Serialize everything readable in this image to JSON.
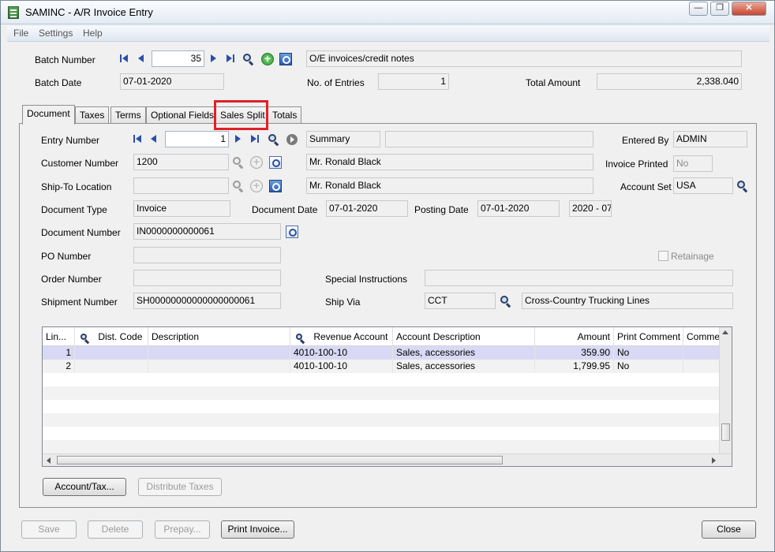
{
  "window": {
    "title": "SAMINC - A/R Invoice Entry"
  },
  "menu": [
    "File",
    "Settings",
    "Help"
  ],
  "batch": {
    "number_label": "Batch Number",
    "number": "35",
    "description": "O/E invoices/credit notes",
    "date_label": "Batch Date",
    "date": "07-01-2020",
    "entries_label": "No. of Entries",
    "entries": "1",
    "total_label": "Total Amount",
    "total": "2,338.040"
  },
  "tabs": [
    "Document",
    "Taxes",
    "Terms",
    "Optional Fields",
    "Sales Split",
    "Totals"
  ],
  "active_tab": "Sales Split",
  "document": {
    "entry_number_label": "Entry Number",
    "entry_number": "1",
    "entry_desc": "Summary",
    "entry_desc2": "",
    "entered_by_label": "Entered By",
    "entered_by": "ADMIN",
    "customer_label": "Customer Number",
    "customer": "1200",
    "customer_name": "Mr. Ronald Black",
    "invoice_printed_label": "Invoice Printed",
    "invoice_printed": "No",
    "shipto_label": "Ship-To Location",
    "shipto": "",
    "shipto_name": "Mr. Ronald Black",
    "account_set_label": "Account Set",
    "account_set": "USA",
    "doctype_label": "Document Type",
    "doctype": "Invoice",
    "docdate_label": "Document Date",
    "docdate": "07-01-2020",
    "postdate_label": "Posting Date",
    "postdate": "07-01-2020",
    "period": "2020 - 07",
    "docnum_label": "Document Number",
    "docnum": "IN0000000000061",
    "po_label": "PO Number",
    "po": "",
    "retainage_label": "Retainage",
    "order_label": "Order Number",
    "order": "",
    "special_label": "Special Instructions",
    "special": "",
    "shipment_label": "Shipment Number",
    "shipment": "SH00000000000000000061",
    "shipvia_label": "Ship Via",
    "shipvia": "CCT",
    "shipvia_name": "Cross-Country Trucking Lines"
  },
  "grid": {
    "headers": [
      "Lin...",
      "Dist. Code",
      "Description",
      "Revenue Account",
      "Account Description",
      "Amount",
      "Print Comment",
      "Commen"
    ],
    "rows": [
      {
        "line": "1",
        "dist": "",
        "desc": "",
        "account": "4010-100-10",
        "account_desc": "Sales, accessories",
        "amount": "359.90",
        "print": "No",
        "comment": ""
      },
      {
        "line": "2",
        "dist": "",
        "desc": "",
        "account": "4010-100-10",
        "account_desc": "Sales, accessories",
        "amount": "1,799.95",
        "print": "No",
        "comment": ""
      }
    ]
  },
  "buttons": {
    "account_tax": "Account/Tax...",
    "distribute": "Distribute Taxes",
    "save": "Save",
    "delete": "Delete",
    "prepay": "Prepay...",
    "print": "Print Invoice...",
    "close": "Close"
  }
}
